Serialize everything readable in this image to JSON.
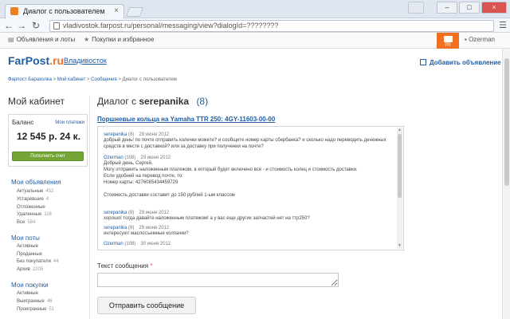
{
  "browser": {
    "tab_title": "Диалог с пользователем",
    "url": "vladivostok.farpost.ru/personal/messaging/view?dialogId=????????"
  },
  "site": {
    "topbar": {
      "ads_label": "Объявления и лоты",
      "purchases_label": "Покупки и избранное",
      "mail_count": "(8)",
      "username": "Ozerman"
    },
    "logo_main": "FarPost",
    "logo_ru": ".ru",
    "city": "Владивосток",
    "add_ad": "Добавить объявление",
    "breadcrumbs": [
      "Фарпост Барахолка",
      "Мой кабинет",
      "Сообщения",
      "Диалог с пользователем"
    ]
  },
  "sidebar": {
    "title": "Мой кабинет",
    "balance": {
      "label": "Баланс",
      "payments": "Мои платежи",
      "amount": "12 545 р. 24 к.",
      "topup": "Пополнить счет"
    },
    "sections": [
      {
        "title": "Мои объявления",
        "items": [
          {
            "label": "Актуальные",
            "count": "452"
          },
          {
            "label": "Устаревшие",
            "count": "4"
          },
          {
            "label": "Отложенные",
            "count": ""
          },
          {
            "label": "Удаленные",
            "count": "116"
          },
          {
            "label": "Все",
            "count": "584"
          }
        ]
      },
      {
        "title": "Мои поты",
        "items": [
          {
            "label": "Активные",
            "count": ""
          },
          {
            "label": "Проданные",
            "count": ""
          },
          {
            "label": "Без покупателя",
            "count": "44"
          },
          {
            "label": "Архив",
            "count": "2205"
          }
        ]
      },
      {
        "title": "Мои покупки",
        "items": [
          {
            "label": "Активные",
            "count": ""
          },
          {
            "label": "Выигранные",
            "count": "46"
          },
          {
            "label": "Проигранные",
            "count": "51"
          }
        ]
      }
    ]
  },
  "dialog": {
    "title_prefix": "Диалог с",
    "username": "serepanika",
    "count": "(8)",
    "ad_title": "Поршневые кольца на Yamaha TTR 250: 4GY-11603-00-00",
    "messages": [
      {
        "author": "serepanika",
        "rating": "(8)",
        "date": "29 июня 2012",
        "lines": [
          "добрый день! по почте отправить колечки можете? и сообщите номер карты сбербанка? и сколько надо переводить денежных",
          "средств в месте с доставкой? или за доставку при получении на почте?"
        ]
      },
      {
        "author": "Ozerman",
        "rating": "(108)",
        "date": "29 июня 2012",
        "lines": [
          "Добрый день, Сергей.",
          "Могу отправить наложенным платежом, в который будет включено все - и стоимость колец и стоимость доставки.",
          "Если удобней на перевод почте, то:",
          "Номер карты: 4276085434459729",
          "",
          "Стоимость доставки составит до 150 рублей 1-ым классом"
        ]
      },
      {
        "author": "serepanika",
        "rating": "(8)",
        "date": "29 июня 2012",
        "lines": [
          "хорошо! тогда давайте наложенным платежом! а у вас еще других запчастей нет на ттр250?"
        ]
      },
      {
        "author": "serepanika",
        "rating": "(8)",
        "date": "29 июня 2012",
        "lines": [
          "интересуют маслосъемные колпачки?"
        ]
      },
      {
        "author": "Ozerman",
        "rating": "(108)",
        "date": "30 июня 2012",
        "lines": []
      }
    ],
    "reply_label": "Текст сообщения",
    "reply_required": "*",
    "reply_value": "",
    "send_label": "Отправить сообщение"
  }
}
